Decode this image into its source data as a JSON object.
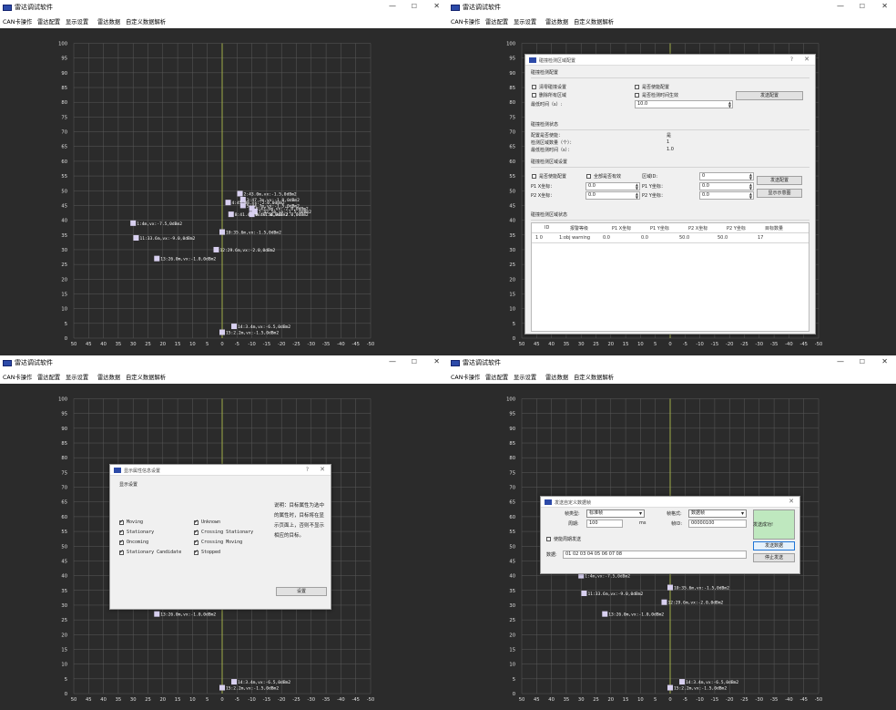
{
  "app": {
    "title": "雷达调试软件",
    "menus": [
      "CAN卡操作",
      "雷达配置",
      "显示设置",
      "雷达数据",
      "自定义数据解析"
    ],
    "window_controls": {
      "min": "—",
      "max": "☐",
      "close": "✕"
    }
  },
  "plot": {
    "y_ticks": [
      "100",
      "95",
      "90",
      "85",
      "80",
      "75",
      "70",
      "65",
      "60",
      "55",
      "50",
      "45",
      "40",
      "35",
      "30",
      "25",
      "20",
      "15",
      "10",
      "5",
      "0"
    ],
    "x_ticks": [
      "50",
      "45",
      "40",
      "35",
      "30",
      "25",
      "20",
      "15",
      "10",
      "5",
      "0",
      "-5",
      "-10",
      "-15",
      "-20",
      "-25",
      "-30",
      "-35",
      "-40",
      "-45",
      "-50"
    ],
    "targets_full": [
      {
        "x": -6,
        "y": 49,
        "label": "2:43.0m,vx:-1.5,0dBm2"
      },
      {
        "x": -7,
        "y": 47,
        "label": "3:47.2m,vx:-1.0,0dBm2"
      },
      {
        "x": -2,
        "y": 46,
        "label": "4:45.0m,vx:-2.0,0dBm2"
      },
      {
        "x": -7,
        "y": 45,
        "label": "5:44.7m,vx:-1.5,0dBm2"
      },
      {
        "x": -10,
        "y": 44,
        "label": "6:43.6m,vx:-2.0,0dBm2"
      },
      {
        "x": -11,
        "y": 43,
        "label": "7:42.5m,vx:-1.5,0dBm2"
      },
      {
        "x": -3,
        "y": 42,
        "label": "8:41.4m,vx:-1.0,0dBm2"
      },
      {
        "x": -10,
        "y": 42,
        "label": "9:40.5m,vx:-2.0,0dBm2"
      },
      {
        "x": 30,
        "y": 39,
        "label": "1:4m,vx:-7.5,0dBm2"
      },
      {
        "x": 0,
        "y": 36,
        "label": "10:35.6m,vx:-1.5,0dBm2"
      },
      {
        "x": 29,
        "y": 34,
        "label": "11:33.6m,vx:-9.0,0dBm2"
      },
      {
        "x": 2,
        "y": 30,
        "label": "12:29.6m,vx:-2.0,0dBm2"
      },
      {
        "x": 22,
        "y": 27,
        "label": "13:26.0m,vx:-1.0,0dBm2"
      },
      {
        "x": -4,
        "y": 4,
        "label": "14:3.4m,vx:-6.5,0dBm2"
      },
      {
        "x": 0,
        "y": 2,
        "label": "15:2.2m,vx:-1.5,0dBm2"
      }
    ],
    "targets_partial": [
      {
        "x": 22,
        "y": 27,
        "label": "13:26.0m,vx:-1.0,0dBm2"
      },
      {
        "x": -4,
        "y": 4,
        "label": "14:3.4m,vx:-6.5,0dBm2"
      },
      {
        "x": 0,
        "y": 2,
        "label": "15:2.2m,vx:-1.5,0dBm2"
      }
    ],
    "targets_w3": [
      {
        "x": 30,
        "y": 40,
        "label": "1:4m,vx:-7.5,0dBm2"
      },
      {
        "x": 29,
        "y": 34,
        "label": "11:33.6m,vx:-9.0,0dBm2"
      },
      {
        "x": 0,
        "y": 36,
        "label": "10:35.6m,vx:-1.5,0dBm2"
      },
      {
        "x": 2,
        "y": 31,
        "label": "12:29.6m,vx:-2.0,0dBm2"
      },
      {
        "x": 22,
        "y": 27,
        "label": "13:26.0m,vx:-1.0,0dBm2"
      },
      {
        "x": -4,
        "y": 4,
        "label": "14:3.4m,vx:-6.5,0dBm2"
      },
      {
        "x": 0,
        "y": 2,
        "label": "15:2.2m,vx:-1.5,0dBm2"
      }
    ]
  },
  "cfg": {
    "title": "碰撞检测区域配置",
    "sec1": "碰撞检测配置",
    "cb_clear": "清零碰撞设置",
    "cb_delete": "删除所有区域",
    "cb_enable": "是否使能配置",
    "cb_time": "是否检测时间生效",
    "min_time_label": "最低时间（s）:",
    "min_time_value": "10.0",
    "send_btn": "发送配置",
    "sec2": "碰撞检测状态",
    "status_labels": [
      "配置是否使能：",
      "检测区域数量（个）：",
      "最低检测时间（s）："
    ],
    "status_values": [
      "是",
      "1",
      "1.0"
    ],
    "sec3": "碰撞检测区域设置",
    "cb_region_enable": "是否使能配置",
    "cb_all_valid": "全部是否有效",
    "region_id_label": "区域ID:",
    "region_id_value": "0",
    "send_btn2": "发送配置",
    "show_fig_btn": "显示示意图",
    "p1x_label": "P1 X坐标：",
    "p1x_value": "0.0",
    "p1y_label": "P1 Y坐标：",
    "p1y_value": "0.0",
    "p2x_label": "P2 X坐标：",
    "p2x_value": "0.0",
    "p2y_label": "P2 Y坐标：",
    "p2y_value": "0.0",
    "sec4": "碰撞检测区域状态",
    "table_headers": [
      "ID",
      "报警等级",
      "P1 X坐标",
      "P1 Y坐标",
      "P2 X坐标",
      "P2 Y坐标",
      "目标数量"
    ],
    "table_row": [
      "1  0",
      "1:obj warning",
      "0.0",
      "0.0",
      "50.0",
      "50.0",
      "17"
    ],
    "help": "?",
    "close": "✕"
  },
  "disp": {
    "title": "显示属性信息设置",
    "section": "显示设置",
    "left_checks": [
      "Moving",
      "Stationary",
      "Oncoming",
      "Stationary Candidate"
    ],
    "right_checks": [
      "Unknown",
      "Crossing Stationary",
      "Crossing Moving",
      "Stopped"
    ],
    "note": "说明：目标属性为选中的属性时，目标将在显示页面上，否则不显示相应的目标。",
    "button": "设置",
    "help": "?",
    "close": "✕"
  },
  "send": {
    "title": "发送自定义数据帧",
    "frame_type_label": "帧类型:",
    "frame_type_value": "标准帧",
    "frame_format_label": "帧格式:",
    "frame_format_value": "数据帧",
    "period_label": "周期:",
    "period_value": "100",
    "period_unit": "ms",
    "frame_id_label": "帧ID:",
    "frame_id_value": "00000100",
    "status": "发送成功!",
    "cyclic_label": "使能周期发送",
    "data_label": "数据:",
    "data_value": "01 02 03 04 05 06 07 08",
    "send_btn": "发送数据",
    "stop_btn": "停止发送",
    "close": "✕"
  }
}
